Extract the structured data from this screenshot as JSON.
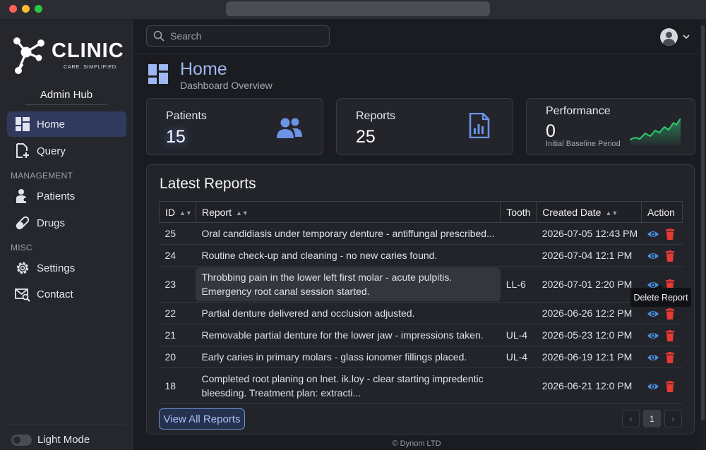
{
  "app": {
    "logo_text": "CLINIC",
    "logo_tagline": "CARE. SIMPLIFIED.",
    "hub_title": "Admin Hub"
  },
  "sidebar": {
    "items": [
      {
        "label": "Home",
        "icon": "dashboard-icon",
        "active": true
      },
      {
        "label": "Query",
        "icon": "add-document-icon"
      }
    ],
    "sections": [
      {
        "label": "MANAGEMENT",
        "items": [
          {
            "label": "Patients",
            "icon": "patient-icon"
          },
          {
            "label": "Drugs",
            "icon": "pill-icon"
          }
        ]
      },
      {
        "label": "MISC",
        "items": [
          {
            "label": "Settings",
            "icon": "gear-icon"
          },
          {
            "label": "Contact",
            "icon": "contact-mail-icon"
          }
        ]
      }
    ],
    "light_mode_label": "Light Mode"
  },
  "header": {
    "search_placeholder": "Search"
  },
  "page": {
    "title": "Home",
    "subtitle": "Dashboard Overview"
  },
  "cards": [
    {
      "label": "Patients",
      "value": "15",
      "icon": "users-icon"
    },
    {
      "label": "Reports",
      "value": "25",
      "icon": "report-chart-icon"
    },
    {
      "label": "Performance",
      "value": "0",
      "caption": "Initial Baseline Period",
      "icon": "sparkline-chart"
    }
  ],
  "reports": {
    "title": "Latest Reports",
    "columns": [
      "ID",
      "Report",
      "Tooth",
      "Created Date",
      "Action"
    ],
    "rows": [
      {
        "id": "25",
        "report": "Oral candidiasis under temporary denture - antiffungal prescribed...",
        "tooth": "",
        "date": "2026-07-05 12:43 PM"
      },
      {
        "id": "24",
        "report": "Routine check-up and cleaning - no new caries found.",
        "tooth": "",
        "date": "2026-07-04 12:1 PM"
      },
      {
        "id": "23",
        "report": "Throbbing pain in the lower left first molar - acute pulpitis. Emergency root canal session started.",
        "tooth": "LL-6",
        "date": "2026-07-01 2:20 PM"
      },
      {
        "id": "22",
        "report": "Partial denture delivered and occlusion adjusted.",
        "tooth": "",
        "date": "2026-06-26 12:2 PM"
      },
      {
        "id": "21",
        "report": "Removable partial denture for the lower jaw - impressions taken.",
        "tooth": "UL-4",
        "date": "2026-05-23 12:0 PM"
      },
      {
        "id": "20",
        "report": "Early caries in primary molars - glass ionomer fillings placed.",
        "tooth": "UL-4",
        "date": "2026-06-19 12:1 PM"
      },
      {
        "id": "18",
        "report": "Completed root planing on lnet. ik.loy - clear starting impredentic bleesding. Treatment plan: extracti...",
        "tooth": "",
        "date": "2026-06-21 12:0 PM"
      }
    ],
    "tooltip": "Delete Report",
    "view_all_label": "View All Reports",
    "pagination": {
      "prev": "‹",
      "current": "1",
      "next": "›"
    }
  },
  "footer": {
    "text": "© Dynom LTD"
  },
  "colors": {
    "accent": "#9db8f2",
    "view_icon": "#4a90e2",
    "delete_icon": "#e53935",
    "sparkline": "#2ecc71"
  }
}
